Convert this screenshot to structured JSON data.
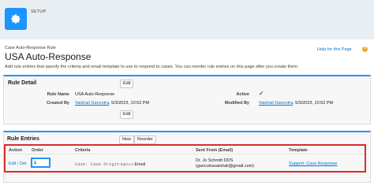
{
  "header": {
    "setup_label": "SETUP"
  },
  "page": {
    "breadcrumb": "Case Auto-Response Rule",
    "title": "USA Auto-Response",
    "help_link": "Help for this Page",
    "description": "Add rule entries that specify the criteria and email template to use to respond to cases. You can reorder rule entries on this page after you create them."
  },
  "rule_detail": {
    "title": "Rule Detail",
    "edit_label": "Edit",
    "rule_name_label": "Rule Name",
    "rule_name": "USA Auto-Response",
    "active_label": "Active",
    "active_checked": true,
    "created_by_label": "Created By",
    "created_by_user": "Vaishali Gancotra",
    "created_by_date": ", 5/3/2023, 10:52 PM",
    "modified_by_label": "Modified By",
    "modified_by_user": "Vaishali Gancotra",
    "modified_by_date": ", 5/3/2023, 10:52 PM"
  },
  "rule_entries": {
    "title": "Rule Entries",
    "new_label": "New",
    "reorder_label": "Reorder",
    "columns": [
      "Action",
      "Order",
      "Criteria",
      "Sent From (Email)",
      "Template"
    ],
    "rows": [
      {
        "action_edit": "Edit",
        "action_sep": " | ",
        "action_del": "Del",
        "order": "1",
        "criteria_field": "Case: Case Origin",
        "criteria_op": "EQUALS",
        "criteria_value": "Email",
        "sent_from_name": "Dr. Jo Schmitt DDS",
        "sent_from_email": "(gancotravaishali@gmail.com)",
        "template": "Support: Case Response"
      }
    ]
  },
  "colors": {
    "accent": "#1b96ff",
    "link": "#0176d3",
    "highlight": "#d92c2c"
  }
}
